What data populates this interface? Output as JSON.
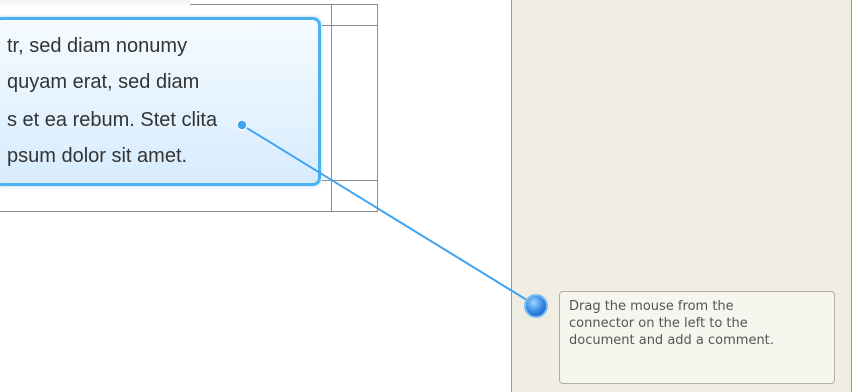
{
  "document": {
    "text_lines": [
      "tr, sed diam nonumy",
      "quyam erat, sed diam",
      "s et ea rebum. Stet clita",
      "psum dolor sit amet."
    ]
  },
  "comment_pane": {
    "hint": "Drag the mouse from the\nconnector on the left to the\ndocument and add a comment."
  },
  "colors": {
    "connector": "#3fa3f0",
    "selection_border": "#4db0f2",
    "pane_background": "#f0eee3"
  }
}
